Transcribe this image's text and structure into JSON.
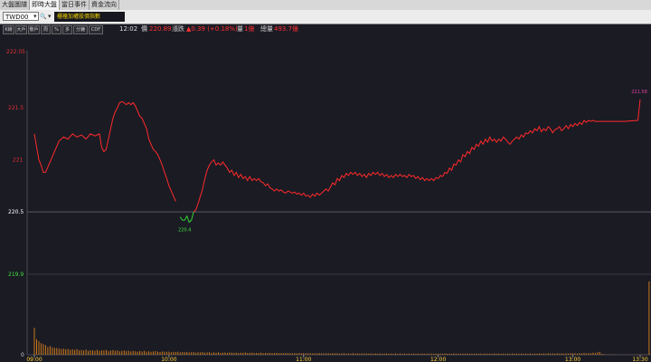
{
  "tabs": [
    "大盤圖譜",
    "即時大盤",
    "當日事件",
    "資金流向"
  ],
  "toolbar": {
    "symbol_value": "TWD00",
    "dropdown_glyph": "▾",
    "search_glyph": "🔍",
    "extra_glyph": "▾",
    "index_name": "櫃檯加權股價指數",
    "buttons": [
      "K線",
      "大戶",
      "散戶",
      "周",
      "%",
      "多",
      "分鐘",
      "CDF"
    ]
  },
  "info": {
    "time": "12:02",
    "price_label": "價",
    "price": "220.89",
    "change_label": "漲跌",
    "change": "▲0.39 (+0.18%)",
    "volume_label": "量",
    "volume": "1億",
    "total_label": "總量",
    "total": "493.7億"
  },
  "colors": {
    "up": "#ff2a2a",
    "down": "#33d133",
    "axis_label": "#e03030",
    "low_label": "#40e040",
    "grid": "#3a3a44",
    "volume": "#cc7a1a",
    "last_value": "#e040a0"
  },
  "chart_data": {
    "type": "line",
    "y_ticks": [
      "221.5",
      "221",
      "220.5"
    ],
    "y_top_label": "222.05",
    "y_bottom_label": "219.9",
    "ylim": [
      219.9,
      222.05
    ],
    "reference": 220.5,
    "x_ticks": [
      "09:00",
      "10:00",
      "11:00",
      "12:00",
      "13:00",
      "13:30"
    ],
    "x_minutes": [
      0,
      60,
      120,
      180,
      240,
      270
    ],
    "low_annotation": {
      "text": "220.4",
      "minute": 67
    },
    "last_annotation": "221.58",
    "price_series": [
      [
        0,
        221.25
      ],
      [
        2,
        221.0
      ],
      [
        3,
        220.95
      ],
      [
        4,
        220.88
      ],
      [
        5,
        220.88
      ],
      [
        7,
        220.98
      ],
      [
        9,
        221.08
      ],
      [
        11,
        221.18
      ],
      [
        13,
        221.22
      ],
      [
        15,
        221.2
      ],
      [
        17,
        221.25
      ],
      [
        19,
        221.22
      ],
      [
        21,
        221.24
      ],
      [
        23,
        221.2
      ],
      [
        25,
        221.25
      ],
      [
        27,
        221.23
      ],
      [
        29,
        221.25
      ],
      [
        30,
        221.12
      ],
      [
        31,
        221.08
      ],
      [
        32,
        221.1
      ],
      [
        33,
        221.2
      ],
      [
        34,
        221.3
      ],
      [
        35,
        221.4
      ],
      [
        36,
        221.46
      ],
      [
        37,
        221.5
      ],
      [
        38,
        221.55
      ],
      [
        39,
        221.56
      ],
      [
        40,
        221.55
      ],
      [
        41,
        221.53
      ],
      [
        42,
        221.55
      ],
      [
        43,
        221.53
      ],
      [
        44,
        221.55
      ],
      [
        45,
        221.52
      ],
      [
        46,
        221.47
      ],
      [
        47,
        221.42
      ],
      [
        48,
        221.4
      ],
      [
        49,
        221.35
      ],
      [
        50,
        221.3
      ],
      [
        51,
        221.2
      ],
      [
        52,
        221.15
      ],
      [
        53,
        221.1
      ],
      [
        54,
        221.08
      ],
      [
        55,
        221.05
      ],
      [
        56,
        221.0
      ],
      [
        57,
        220.95
      ],
      [
        58,
        220.88
      ],
      [
        59,
        220.82
      ],
      [
        60,
        220.75
      ],
      [
        61,
        220.7
      ],
      [
        62,
        220.65
      ],
      [
        63,
        220.6
      ],
      [
        64,
        220.55
      ],
      [
        65,
        220.45
      ],
      [
        66,
        220.42
      ],
      [
        67,
        220.42
      ],
      [
        68,
        220.46
      ],
      [
        69,
        220.4
      ],
      [
        70,
        220.42
      ],
      [
        71,
        220.5
      ],
      [
        72,
        220.52
      ],
      [
        73,
        220.58
      ],
      [
        74,
        220.65
      ],
      [
        75,
        220.72
      ],
      [
        76,
        220.82
      ],
      [
        77,
        220.9
      ],
      [
        78,
        220.95
      ],
      [
        79,
        220.98
      ],
      [
        80,
        221.0
      ],
      [
        81,
        220.95
      ],
      [
        82,
        220.97
      ],
      [
        83,
        220.95
      ],
      [
        84,
        220.98
      ],
      [
        85,
        220.95
      ],
      [
        86,
        220.92
      ],
      [
        87,
        220.88
      ],
      [
        88,
        220.9
      ],
      [
        89,
        220.85
      ],
      [
        90,
        220.88
      ],
      [
        91,
        220.83
      ],
      [
        92,
        220.86
      ],
      [
        93,
        220.82
      ],
      [
        94,
        220.84
      ],
      [
        95,
        220.8
      ],
      [
        96,
        220.84
      ],
      [
        97,
        220.8
      ],
      [
        98,
        220.82
      ],
      [
        99,
        220.8
      ],
      [
        100,
        220.82
      ],
      [
        101,
        220.79
      ],
      [
        102,
        220.78
      ],
      [
        103,
        220.75
      ],
      [
        104,
        220.77
      ],
      [
        105,
        220.73
      ],
      [
        106,
        220.72
      ],
      [
        107,
        220.7
      ],
      [
        108,
        220.72
      ],
      [
        109,
        220.7
      ],
      [
        110,
        220.71
      ],
      [
        111,
        220.69
      ],
      [
        112,
        220.68
      ],
      [
        113,
        220.7
      ],
      [
        114,
        220.69
      ],
      [
        115,
        220.68
      ],
      [
        116,
        220.69
      ],
      [
        117,
        220.67
      ],
      [
        118,
        220.68
      ],
      [
        119,
        220.66
      ],
      [
        120,
        220.68
      ],
      [
        121,
        220.65
      ],
      [
        122,
        220.66
      ],
      [
        123,
        220.64
      ],
      [
        124,
        220.67
      ],
      [
        125,
        220.65
      ],
      [
        126,
        220.68
      ],
      [
        127,
        220.66
      ],
      [
        128,
        220.68
      ],
      [
        129,
        220.7
      ],
      [
        130,
        220.72
      ],
      [
        131,
        220.7
      ],
      [
        132,
        220.74
      ],
      [
        133,
        220.78
      ],
      [
        134,
        220.76
      ],
      [
        135,
        220.82
      ],
      [
        136,
        220.8
      ],
      [
        137,
        220.85
      ],
      [
        138,
        220.83
      ],
      [
        139,
        220.87
      ],
      [
        140,
        220.85
      ],
      [
        141,
        220.88
      ],
      [
        142,
        220.86
      ],
      [
        143,
        220.88
      ],
      [
        144,
        220.85
      ],
      [
        145,
        220.87
      ],
      [
        146,
        220.84
      ],
      [
        147,
        220.86
      ],
      [
        148,
        220.83
      ],
      [
        149,
        220.87
      ],
      [
        150,
        220.85
      ],
      [
        151,
        220.88
      ],
      [
        152,
        220.86
      ],
      [
        153,
        220.88
      ],
      [
        154,
        220.85
      ],
      [
        155,
        220.87
      ],
      [
        156,
        220.84
      ],
      [
        157,
        220.86
      ],
      [
        158,
        220.83
      ],
      [
        159,
        220.85
      ],
      [
        160,
        220.83
      ],
      [
        161,
        220.86
      ],
      [
        162,
        220.84
      ],
      [
        163,
        220.86
      ],
      [
        164,
        220.84
      ],
      [
        165,
        220.85
      ],
      [
        166,
        220.83
      ],
      [
        167,
        220.86
      ],
      [
        168,
        220.84
      ],
      [
        169,
        220.85
      ],
      [
        170,
        220.82
      ],
      [
        171,
        220.84
      ],
      [
        172,
        220.81
      ],
      [
        173,
        220.83
      ],
      [
        174,
        220.8
      ],
      [
        175,
        220.82
      ],
      [
        176,
        220.8
      ],
      [
        177,
        220.82
      ],
      [
        178,
        220.8
      ],
      [
        179,
        220.83
      ],
      [
        180,
        220.82
      ],
      [
        181,
        220.85
      ],
      [
        182,
        220.84
      ],
      [
        183,
        220.88
      ],
      [
        184,
        220.87
      ],
      [
        185,
        220.92
      ],
      [
        186,
        220.9
      ],
      [
        187,
        220.96
      ],
      [
        188,
        220.95
      ],
      [
        189,
        221.0
      ],
      [
        190,
        220.98
      ],
      [
        191,
        221.05
      ],
      [
        192,
        221.03
      ],
      [
        193,
        221.08
      ],
      [
        194,
        221.06
      ],
      [
        195,
        221.12
      ],
      [
        196,
        221.1
      ],
      [
        197,
        221.15
      ],
      [
        198,
        221.13
      ],
      [
        199,
        221.18
      ],
      [
        200,
        221.15
      ],
      [
        201,
        221.2
      ],
      [
        202,
        221.17
      ],
      [
        203,
        221.22
      ],
      [
        204,
        221.18
      ],
      [
        205,
        221.2
      ],
      [
        206,
        221.17
      ],
      [
        207,
        221.2
      ],
      [
        208,
        221.18
      ],
      [
        209,
        221.22
      ],
      [
        210,
        221.2
      ],
      [
        211,
        221.17
      ],
      [
        212,
        221.15
      ],
      [
        213,
        221.18
      ],
      [
        214,
        221.2
      ],
      [
        215,
        221.22
      ],
      [
        216,
        221.2
      ],
      [
        217,
        221.24
      ],
      [
        218,
        221.22
      ],
      [
        219,
        221.26
      ],
      [
        220,
        221.25
      ],
      [
        221,
        221.28
      ],
      [
        222,
        221.26
      ],
      [
        223,
        221.3
      ],
      [
        224,
        221.28
      ],
      [
        225,
        221.32
      ],
      [
        226,
        221.27
      ],
      [
        227,
        221.3
      ],
      [
        228,
        221.28
      ],
      [
        229,
        221.32
      ],
      [
        230,
        221.3
      ],
      [
        231,
        221.26
      ],
      [
        232,
        221.29
      ],
      [
        233,
        221.3
      ],
      [
        234,
        221.32
      ],
      [
        235,
        221.28
      ],
      [
        236,
        221.3
      ],
      [
        237,
        221.33
      ],
      [
        238,
        221.3
      ],
      [
        239,
        221.34
      ],
      [
        240,
        221.32
      ],
      [
        241,
        221.35
      ],
      [
        242,
        221.33
      ],
      [
        243,
        221.36
      ],
      [
        244,
        221.34
      ],
      [
        245,
        221.38
      ],
      [
        246,
        221.36
      ],
      [
        247,
        221.38
      ],
      [
        248,
        221.37
      ],
      [
        249,
        221.38
      ],
      [
        250,
        221.37
      ],
      [
        251,
        221.37
      ],
      [
        252,
        221.37
      ],
      [
        253,
        221.37
      ],
      [
        254,
        221.37
      ],
      [
        255,
        221.37
      ],
      [
        256,
        221.37
      ],
      [
        257,
        221.37
      ],
      [
        258,
        221.37
      ],
      [
        259,
        221.37
      ],
      [
        260,
        221.37
      ],
      [
        261,
        221.37
      ],
      [
        262,
        221.37
      ],
      [
        263,
        221.37
      ],
      [
        269,
        221.38
      ],
      [
        270,
        221.58
      ]
    ],
    "volume_series": [
      14.0,
      8.0,
      7.0,
      6.0,
      5.5,
      5.0,
      4.0,
      4.5,
      3.8,
      3.5,
      3.5,
      3.2,
      3.0,
      3.2,
      2.8,
      3.0,
      2.6,
      2.8,
      2.5,
      2.9,
      2.3,
      2.5,
      2.2,
      2.7,
      2.0,
      2.4,
      2.3,
      2.1,
      2.6,
      2.0,
      2.3,
      2.2,
      2.5,
      1.9,
      2.2,
      2.4,
      2.0,
      2.3,
      1.8,
      2.0,
      2.2,
      1.9,
      2.1,
      1.7,
      2.0,
      1.8,
      1.6,
      1.9,
      1.7,
      2.0,
      1.6,
      1.8,
      1.5,
      1.7,
      1.9,
      1.6,
      1.4,
      1.7,
      1.6,
      1.5,
      1.6,
      1.3,
      1.5,
      1.4,
      1.6,
      1.2,
      1.4,
      1.3,
      1.5,
      1.2,
      1.3,
      1.4,
      1.1,
      1.3,
      1.2,
      1.4,
      1.1,
      1.2,
      1.3,
      1.0,
      1.2,
      1.1,
      1.3,
      1.0,
      1.1,
      1.2,
      1.0,
      1.2,
      1.1,
      1.0,
      1.1,
      0.9,
      1.1,
      1.0,
      1.2,
      0.9,
      1.0,
      1.1,
      0.9,
      1.0,
      0.9,
      1.1,
      0.8,
      1.0,
      0.9,
      1.0,
      0.8,
      0.9,
      1.0,
      0.8,
      0.9,
      0.8,
      1.0,
      0.8,
      0.9,
      0.8,
      0.9,
      0.7,
      0.9,
      0.8,
      0.9,
      0.7,
      0.8,
      0.9,
      0.7,
      0.8,
      0.7,
      0.9,
      0.7,
      0.8,
      0.7,
      0.8,
      0.6,
      0.8,
      0.7,
      0.8,
      0.6,
      0.7,
      0.8,
      0.6,
      0.7,
      0.6,
      0.8,
      0.6,
      0.7,
      0.6,
      0.7,
      0.6,
      0.7,
      0.6,
      0.7,
      0.5,
      0.7,
      0.6,
      0.7,
      0.5,
      0.6,
      0.7,
      0.5,
      0.6,
      0.5,
      0.7,
      0.5,
      0.6,
      0.5,
      0.6,
      0.5,
      0.6,
      0.5,
      0.6,
      0.5,
      0.6,
      0.5,
      0.6,
      0.5,
      0.6,
      0.5,
      0.6,
      0.5,
      0.6,
      0.5,
      0.6,
      0.5,
      0.7,
      0.5,
      0.6,
      0.5,
      0.7,
      0.5,
      0.6,
      0.5,
      0.6,
      0.5,
      0.6,
      0.5,
      0.6,
      0.5,
      0.6,
      0.5,
      0.6,
      0.5,
      0.6,
      0.5,
      0.6,
      0.5,
      0.7,
      0.5,
      0.6,
      0.5,
      0.6,
      0.5,
      0.6,
      0.5,
      0.7,
      0.5,
      0.6,
      0.5,
      0.6,
      0.5,
      0.6,
      0.5,
      0.7,
      0.5,
      0.6,
      0.5,
      0.7,
      0.6,
      0.7,
      0.5,
      0.8,
      0.6,
      0.7,
      0.5,
      0.8,
      0.6,
      0.7,
      0.6,
      0.8,
      0.6,
      0.9,
      0.7,
      0.8,
      0.6,
      0.9,
      0.7,
      1.0,
      0.7,
      0.9,
      0.8,
      1.1,
      0.9,
      1.3,
      1.5,
      0.5,
      0.3,
      0.2,
      0.2,
      0.2,
      0.1,
      0.1,
      0.1,
      0.1,
      0.1,
      0.1,
      0.1,
      0.1,
      0.1,
      0.1,
      0.1,
      0.1,
      0.1,
      0.1,
      0.1,
      0.1,
      38.0
    ]
  }
}
